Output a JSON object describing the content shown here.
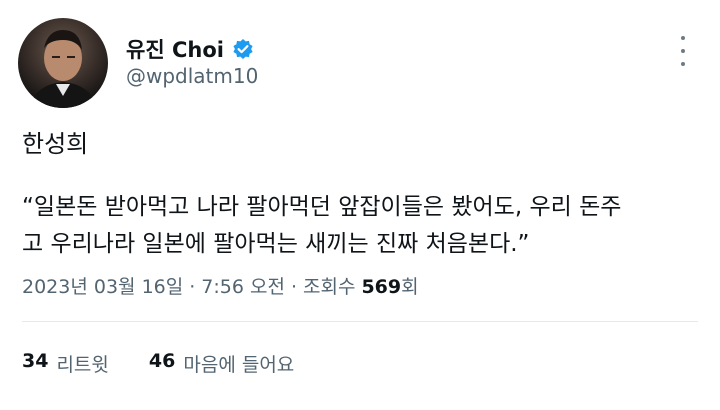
{
  "profile": {
    "display_name": "유진 Choi",
    "handle": "@wpdlatm10",
    "verified_color": "#1d9bf0"
  },
  "tweet": {
    "first_line": "한성희",
    "body": "“일본돈 받아먹고 나라 팔아먹던 앞잡이들은 봤어도, 우리 돈주\n고 우리나라 일본에 팔아먹는 새끼는 진짜 처음본다.”",
    "date": "2023년 03월 16일",
    "sep1": "·",
    "time": "7:56 오전",
    "sep2": "·",
    "views_label": "조회수",
    "views_count": "569",
    "views_suffix": "회"
  },
  "stats": {
    "retweets_count": "34",
    "retweets_label": "리트윗",
    "likes_count": "46",
    "likes_label": "마음에 들어요"
  }
}
